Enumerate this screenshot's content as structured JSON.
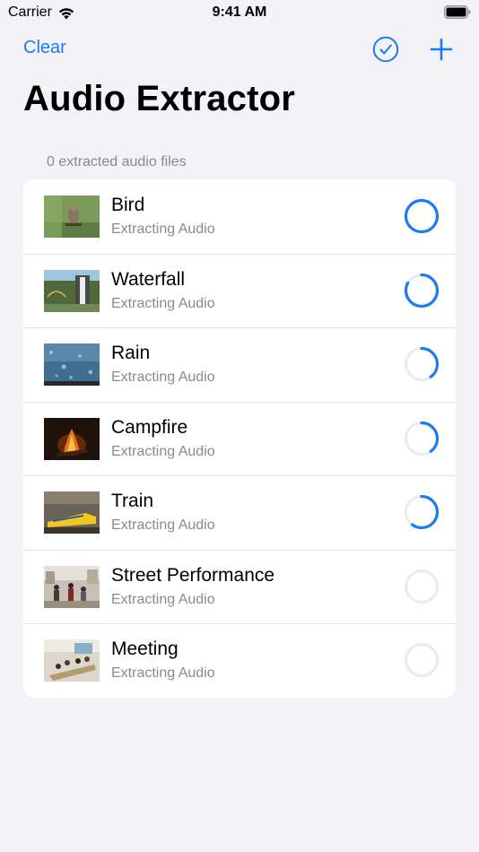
{
  "status_bar": {
    "carrier": "Carrier",
    "time": "9:41 AM"
  },
  "nav": {
    "clear_label": "Clear",
    "select_icon": "checkmark-circle-icon",
    "add_icon": "plus-icon"
  },
  "title": "Audio Extractor",
  "section_header": "0 extracted audio files",
  "accent_color": "#1a7cf4",
  "items": [
    {
      "title": "Bird",
      "subtitle": "Extracting Audio",
      "progress": 1.0,
      "thumbnail": "bird"
    },
    {
      "title": "Waterfall",
      "subtitle": "Extracting Audio",
      "progress": 0.83,
      "thumbnail": "waterfall"
    },
    {
      "title": "Rain",
      "subtitle": "Extracting Audio",
      "progress": 0.4,
      "thumbnail": "rain"
    },
    {
      "title": "Campfire",
      "subtitle": "Extracting Audio",
      "progress": 0.4,
      "thumbnail": "campfire"
    },
    {
      "title": "Train",
      "subtitle": "Extracting Audio",
      "progress": 0.6,
      "thumbnail": "train"
    },
    {
      "title": "Street Performance",
      "subtitle": "Extracting Audio",
      "progress": 0,
      "thumbnail": "street-performance"
    },
    {
      "title": "Meeting",
      "subtitle": "Extracting Audio",
      "progress": 0,
      "thumbnail": "meeting"
    }
  ]
}
